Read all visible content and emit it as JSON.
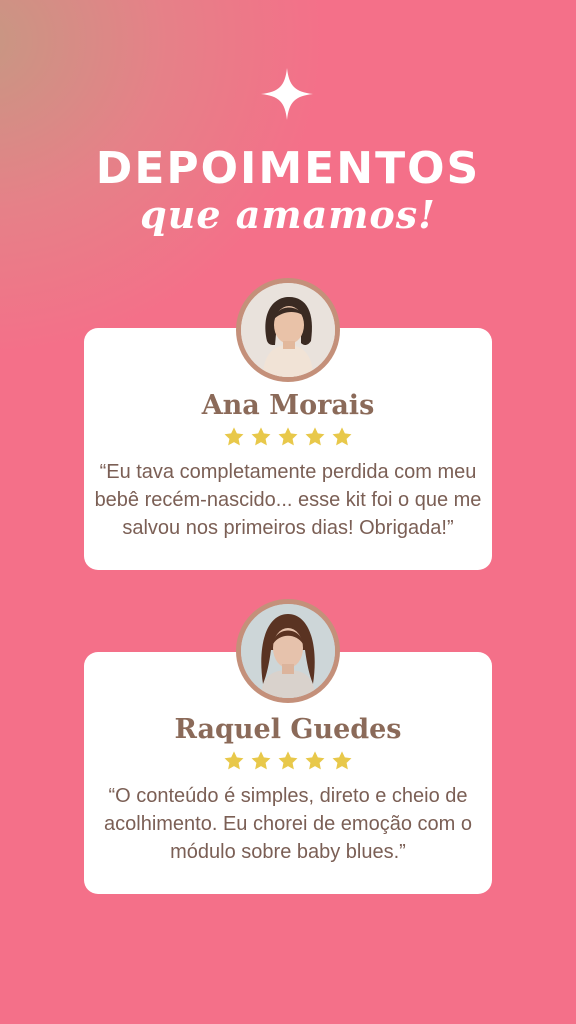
{
  "header": {
    "title": "DEPOIMENTOS",
    "subtitle": "que amamos!",
    "icon": "sparkle-icon"
  },
  "testimonials": [
    {
      "name": "Ana Morais",
      "rating": 5,
      "quote": "“Eu tava completamente perdida com meu bebê recém-nascido... esse kit foi o que me salvou nos primeiros dias! Obrigada!”"
    },
    {
      "name": "Raquel Guedes",
      "rating": 5,
      "quote": "“O conteúdo é simples, direto e cheio de acolhimento. Eu chorei de emoção com o módulo sobre baby blues.”"
    }
  ],
  "colors": {
    "background": "#f47089",
    "card": "#ffffff",
    "name_text": "#8b6a59",
    "quote_text": "#7b5f55",
    "star": "#e8c84a",
    "avatar_border": "#c4907a"
  }
}
